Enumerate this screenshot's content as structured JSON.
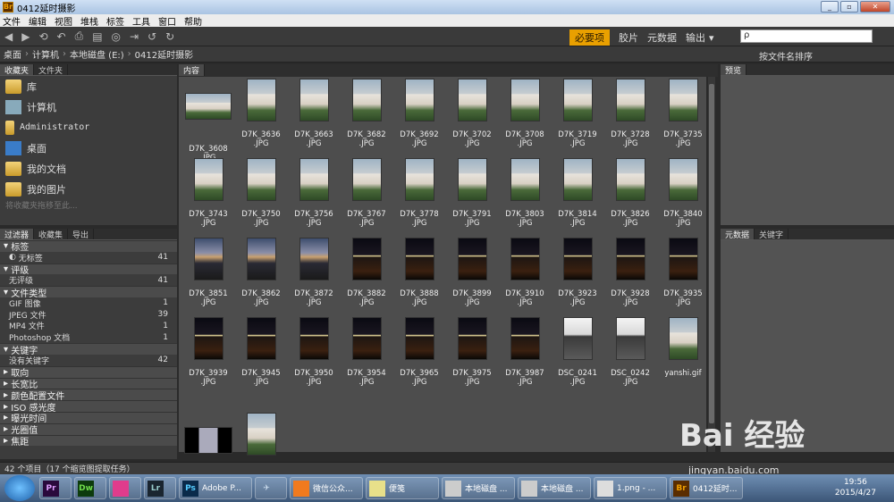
{
  "window": {
    "title": "0412延时摄影",
    "app_icon": "Br"
  },
  "menu": [
    "文件",
    "编辑",
    "视图",
    "堆栈",
    "标签",
    "工具",
    "窗口",
    "帮助"
  ],
  "workspaces": {
    "active": "必要项",
    "items": [
      "胶片",
      "元数据",
      "输出"
    ]
  },
  "search": {
    "placeholder": "ρ"
  },
  "path": [
    "桌面",
    "计算机",
    "本地磁盘 (E:)",
    "0412延时摄影"
  ],
  "sort_label": "按文件名排序",
  "favorites_panel": {
    "tabs": [
      "收藏夹",
      "文件夹"
    ],
    "items": [
      "库",
      "计算机",
      "Administrator",
      "桌面",
      "我的文档",
      "我的图片"
    ],
    "drop_hint": "将收藏夹拖移至此..."
  },
  "filter_panel": {
    "tabs": [
      "过滤器",
      "收藏集",
      "导出"
    ],
    "sections": [
      {
        "title": "标签",
        "rows": [
          {
            "label": "无标签",
            "count": "41"
          }
        ]
      },
      {
        "title": "评级",
        "rows": [
          {
            "label": "无评级",
            "count": "41"
          }
        ]
      },
      {
        "title": "文件类型",
        "rows": [
          {
            "label": "GIF 图像",
            "count": "1"
          },
          {
            "label": "JPEG 文件",
            "count": "39"
          },
          {
            "label": "MP4 文件",
            "count": "1"
          },
          {
            "label": "Photoshop 文档",
            "count": "1"
          }
        ]
      },
      {
        "title": "关键字",
        "rows": [
          {
            "label": "没有关键字",
            "count": "42"
          }
        ]
      }
    ],
    "collapsed": [
      "取向",
      "长宽比",
      "颜色配置文件",
      "ISO 感光度",
      "曝光时间",
      "光圈值",
      "焦距"
    ]
  },
  "content_tab": "内容",
  "preview_tab": "预览",
  "meta_tabs": [
    "元数据",
    "关键字"
  ],
  "thumbs": [
    {
      "n": "D7K_3608",
      "e": ".JPG",
      "k": "day",
      "w": 1
    },
    {
      "n": "D7K_3636",
      "e": ".JPG",
      "k": "day"
    },
    {
      "n": "D7K_3663",
      "e": ".JPG",
      "k": "day"
    },
    {
      "n": "D7K_3682",
      "e": ".JPG",
      "k": "day"
    },
    {
      "n": "D7K_3692",
      "e": ".JPG",
      "k": "day"
    },
    {
      "n": "D7K_3702",
      "e": ".JPG",
      "k": "day"
    },
    {
      "n": "D7K_3708",
      "e": ".JPG",
      "k": "day"
    },
    {
      "n": "D7K_3719",
      "e": ".JPG",
      "k": "day"
    },
    {
      "n": "D7K_3728",
      "e": ".JPG",
      "k": "day"
    },
    {
      "n": "D7K_3735",
      "e": ".JPG",
      "k": "day"
    },
    {
      "n": "D7K_3743",
      "e": ".JPG",
      "k": "day"
    },
    {
      "n": "D7K_3750",
      "e": ".JPG",
      "k": "day"
    },
    {
      "n": "D7K_3756",
      "e": ".JPG",
      "k": "day"
    },
    {
      "n": "D7K_3767",
      "e": ".JPG",
      "k": "day"
    },
    {
      "n": "D7K_3778",
      "e": ".JPG",
      "k": "day"
    },
    {
      "n": "D7K_3791",
      "e": ".JPG",
      "k": "day"
    },
    {
      "n": "D7K_3803",
      "e": ".JPG",
      "k": "day"
    },
    {
      "n": "D7K_3814",
      "e": ".JPG",
      "k": "day"
    },
    {
      "n": "D7K_3826",
      "e": ".JPG",
      "k": "day"
    },
    {
      "n": "D7K_3840",
      "e": ".JPG",
      "k": "day"
    },
    {
      "n": "D7K_3851",
      "e": ".JPG",
      "k": "dusk"
    },
    {
      "n": "D7K_3862",
      "e": ".JPG",
      "k": "dusk"
    },
    {
      "n": "D7K_3872",
      "e": ".JPG",
      "k": "dusk"
    },
    {
      "n": "D7K_3882",
      "e": ".JPG",
      "k": "night"
    },
    {
      "n": "D7K_3888",
      "e": ".JPG",
      "k": "night"
    },
    {
      "n": "D7K_3899",
      "e": ".JPG",
      "k": "night"
    },
    {
      "n": "D7K_3910",
      "e": ".JPG",
      "k": "night"
    },
    {
      "n": "D7K_3923",
      "e": ".JPG",
      "k": "night"
    },
    {
      "n": "D7K_3928",
      "e": ".JPG",
      "k": "night"
    },
    {
      "n": "D7K_3935",
      "e": ".JPG",
      "k": "night"
    },
    {
      "n": "D7K_3939",
      "e": ".JPG",
      "k": "night"
    },
    {
      "n": "D7K_3945",
      "e": ".JPG",
      "k": "night"
    },
    {
      "n": "D7K_3950",
      "e": ".JPG",
      "k": "night"
    },
    {
      "n": "D7K_3954",
      "e": ".JPG",
      "k": "night"
    },
    {
      "n": "D7K_3965",
      "e": ".JPG",
      "k": "night"
    },
    {
      "n": "D7K_3975",
      "e": ".JPG",
      "k": "night"
    },
    {
      "n": "D7K_3987",
      "e": ".JPG",
      "k": "night"
    },
    {
      "n": "DSC_0241",
      "e": ".JPG",
      "k": "person"
    },
    {
      "n": "DSC_0242",
      "e": ".JPG",
      "k": "person"
    },
    {
      "n": "yanshi.gif",
      "e": "",
      "k": "day"
    },
    {
      "n": "",
      "e": "",
      "k": "strip",
      "w": 1
    },
    {
      "n": "",
      "e": "",
      "k": "day"
    }
  ],
  "status": "42 个项目（17 个缩览图提取任务）",
  "taskbar": [
    {
      "label": "",
      "icon": "Pr",
      "bg": "#2a0a3c",
      "fg": "#e0a0ff"
    },
    {
      "label": "",
      "icon": "Dw",
      "bg": "#0d3b0d",
      "fg": "#6fdc4c"
    },
    {
      "label": "",
      "icon": "",
      "bg": "#e03c8c",
      "fg": "#fff"
    },
    {
      "label": "",
      "icon": "Lr",
      "bg": "#1a2530",
      "fg": "#9cc"
    },
    {
      "label": "Adobe P...",
      "icon": "Ps",
      "bg": "#0a2a4a",
      "fg": "#5cf"
    },
    {
      "label": "",
      "icon": "✈",
      "bg": "transparent",
      "fg": "#cde"
    },
    {
      "label": "微信公众...",
      "icon": "",
      "bg": "#f07a1e",
      "fg": "#fff"
    },
    {
      "label": "便笺",
      "icon": "",
      "bg": "#e8e08a",
      "fg": "#333"
    },
    {
      "label": "本地磁盘 ...",
      "icon": "",
      "bg": "#ccc",
      "fg": "#333"
    },
    {
      "label": "本地磁盘 ...",
      "icon": "",
      "bg": "#ccc",
      "fg": "#333"
    },
    {
      "label": "1.png - ...",
      "icon": "",
      "bg": "#ddd",
      "fg": "#333"
    },
    {
      "label": "0412延时...",
      "icon": "Br",
      "bg": "#5a2d00",
      "fg": "#f0a000"
    }
  ],
  "clock": {
    "time": "19:56",
    "date": "2015/4/27"
  },
  "watermark": {
    "brand": "Bai 经验",
    "url": "jingyan.baidu.com"
  }
}
